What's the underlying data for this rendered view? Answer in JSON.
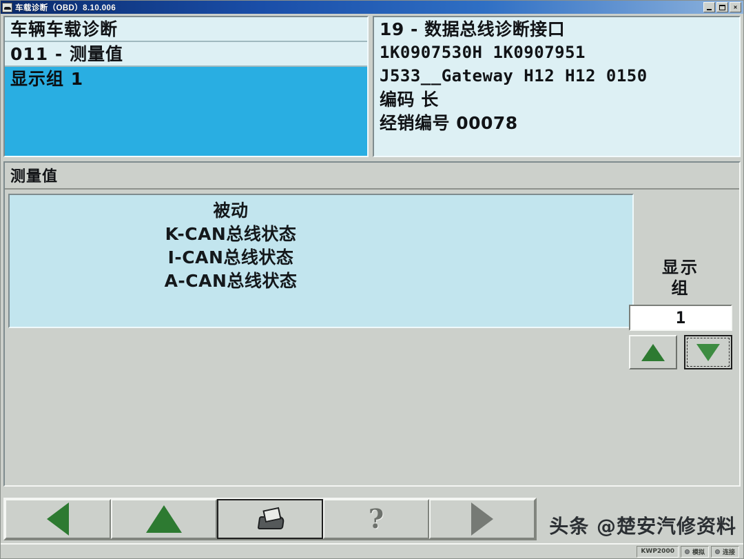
{
  "window": {
    "title": "车载诊断（OBD）8.10.006",
    "icon": "car-icon",
    "minimize_label": "最小化",
    "maximize_label": "最大化",
    "close_label": "×"
  },
  "left_panel": {
    "line1": "车辆车载诊断",
    "line2": "011 -  测量值",
    "line3": "显示组  1",
    "highlight_color": "#29aee2",
    "background_color": "#ddf0f4"
  },
  "right_panel": {
    "line1": "19  -  数据总线诊断接口",
    "line2": "1K0907530H                1K0907951",
    "line3": "J533__Gateway     H12       H12    0150",
    "line4": "编码 长",
    "line5": "经销编号  00078"
  },
  "measured_values": {
    "section_title": "测量值",
    "items": [
      "被动",
      "K-CAN总线状态",
      "I-CAN总线状态",
      "A-CAN总线状态"
    ],
    "box_color": "#c2e5ee"
  },
  "display_group": {
    "label_line1": "显示",
    "label_line2": "组",
    "value": "1",
    "up_button": "increase-display-group",
    "down_button": "decrease-display-group",
    "arrow_color": "#2d7a31"
  },
  "toolbar": {
    "buttons": [
      {
        "name": "back-button",
        "icon": "left-triangle-icon",
        "label": "返回"
      },
      {
        "name": "up-button",
        "icon": "up-triangle-icon",
        "label": "上一级"
      },
      {
        "name": "print-button",
        "icon": "printer-icon",
        "label": "打印"
      },
      {
        "name": "help-button",
        "icon": "question-mark-icon",
        "label": "?"
      },
      {
        "name": "forward-button",
        "icon": "right-triangle-icon",
        "label": "前进"
      }
    ]
  },
  "watermark": {
    "text": "头条 @楚安汽修资料"
  },
  "statusbar": {
    "protocol": "KWP2000",
    "item2": "模拟",
    "item3": "连接"
  }
}
